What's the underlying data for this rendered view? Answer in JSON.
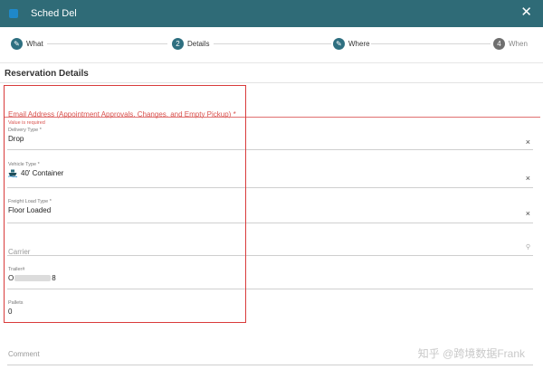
{
  "window": {
    "title": "Sched Del",
    "close_label": "✕"
  },
  "stepper": {
    "steps": [
      {
        "label": "What",
        "marker": "✎",
        "state": "done"
      },
      {
        "label": "Details",
        "marker": "2",
        "state": "active"
      },
      {
        "label": "Where",
        "marker": "✎",
        "state": "done"
      },
      {
        "label": "When",
        "marker": "4",
        "state": "inactive"
      }
    ]
  },
  "section": {
    "title": "Reservation Details"
  },
  "form": {
    "email": {
      "label": "Email Address (Appointment Approvals, Changes, and Empty Pickup) *",
      "error": "Value is required"
    },
    "delivery_type": {
      "label": "Delivery Type *",
      "value": "Drop",
      "clear": "×"
    },
    "vehicle_type": {
      "label": "Vehicle Type *",
      "value": "40' Container",
      "clear": "×"
    },
    "freight_load_type": {
      "label": "Freight Load Type *",
      "value": "Floor Loaded",
      "clear": "×"
    },
    "carrier": {
      "placeholder": "Carrier",
      "search_icon": "⚲"
    },
    "trailer": {
      "label": "Trailer#",
      "value_prefix": "O",
      "value_suffix": "8"
    },
    "pallets": {
      "label": "Pallets",
      "value": "0"
    },
    "comment": {
      "placeholder": "Comment"
    }
  },
  "watermark": {
    "text": "知乎 @跨境数据Frank"
  },
  "colors": {
    "titlebar": "#2f6b77",
    "step_active": "#2e6f80",
    "error": "#d9534f",
    "highlight": "#d93b3b"
  }
}
